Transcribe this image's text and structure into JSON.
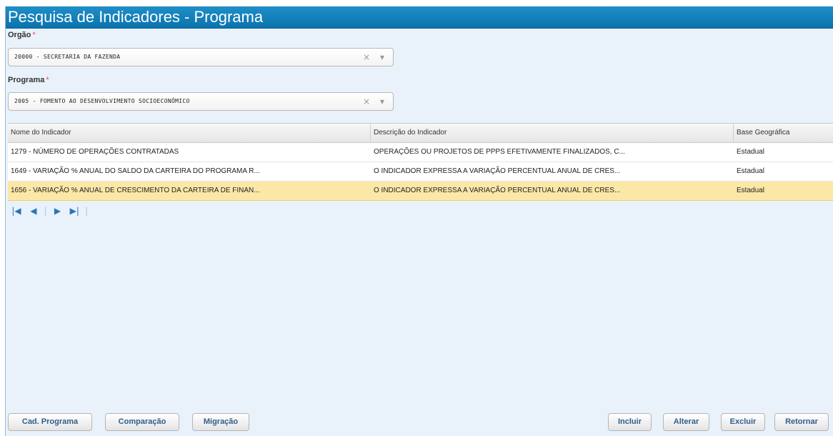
{
  "title": "Pesquisa de Indicadores - Programa",
  "orgao": {
    "label": "Orgão",
    "required_mark": "*",
    "value": "20000 - SECRETARIA DA FAZENDA"
  },
  "programa": {
    "label": "Programa",
    "required_mark": "*",
    "value": "2005 - FOMENTO AO DESENVOLVIMENTO SOCIOECONÔMICO"
  },
  "grid": {
    "columns": [
      "Nome do Indicador",
      "Descrição do Indicador",
      "Base Geográfica"
    ],
    "rows": [
      [
        "1279 - NÚMERO DE OPERAÇÕES CONTRATADAS",
        "OPERAÇÕES OU PROJETOS DE PPPS EFETIVAMENTE FINALIZADOS, C...",
        "Estadual"
      ],
      [
        "1649 - VARIAÇÃO % ANUAL DO SALDO DA CARTEIRA DO PROGRAMA R...",
        "O INDICADOR EXPRESSA A VARIAÇÃO PERCENTUAL ANUAL DE CRES...",
        "Estadual"
      ],
      [
        "1656 - VARIAÇÃO % ANUAL DE CRESCIMENTO DA CARTEIRA DE FINAN...",
        "O INDICADOR EXPRESSA A VARIAÇÃO PERCENTUAL ANUAL DE CRES...",
        "Estadual"
      ]
    ]
  },
  "buttons": {
    "cad_programa": "Cad. Programa",
    "comparacao": "Comparação",
    "migracao": "Migração",
    "incluir": "Incluir",
    "alterar": "Alterar",
    "excluir": "Excluir",
    "retornar": "Retornar"
  },
  "colors": {
    "title_bar": "#0a73ad",
    "panel_background": "#e9f2fb",
    "selected_row": "#fbe8a6",
    "required_mark": "#e24a4a",
    "button_text": "#2f5e8a"
  },
  "icons": {
    "clear": "×",
    "dropdown": "▼",
    "first_page": "|◀",
    "prev_page": "◀",
    "next_page": "▶",
    "last_page": "▶|"
  }
}
